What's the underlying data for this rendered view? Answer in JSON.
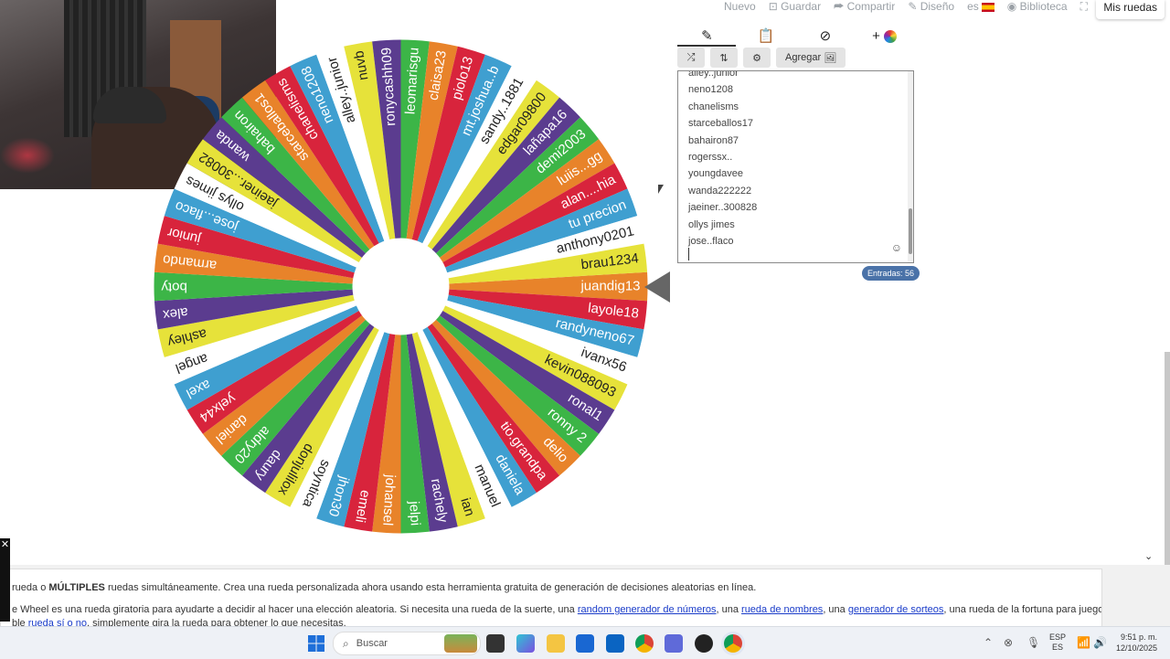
{
  "topnav": {
    "items": [
      "Nuevo",
      "Guardar",
      "Compartir",
      "Diseño",
      "es",
      "Biblioteca"
    ],
    "icons": [
      "",
      "save-icon",
      "share-icon",
      "pencil-icon",
      "spain-flag-icon",
      "palette-icon"
    ],
    "fullscreen_icon": "fullscreen-icon",
    "mis_ruedas": "Mis ruedas"
  },
  "wheel": {
    "segments": [
      "juandig13",
      "layole18",
      "randyneno67",
      "ivanx56",
      "kevin088093",
      "ronal1",
      "ronny 2",
      "delio",
      "tio.grandpa",
      "daniela",
      "manuel",
      "ian",
      "rachely",
      "jelpi",
      "johansel",
      "emeli",
      "jhon30",
      "soyntica",
      "donjulilox",
      "daury",
      "aldry20",
      "daniel",
      "yelx44",
      "axel",
      "angel",
      "ashley",
      "alex",
      "boty",
      "armando",
      "junior",
      "jose...flaco",
      "ollys jimes",
      "jaeiner...30082",
      "wanda",
      "bahairon",
      "starceballos1",
      "chanelisms",
      "neno1208",
      "alley..junior",
      "nuvb",
      "ronycashh09",
      "leomarisgu",
      "claisa23",
      "piolo13",
      "mt.joshua..b",
      "sandy..1881",
      "edgar09800",
      "lañapa16",
      "demi2003",
      "luiis...gg",
      "alan....hia",
      "tu precion",
      "anthony0201",
      "brau1234"
    ],
    "colors": [
      "#e8832a",
      "#d8243c",
      "#3f9fd0",
      "#ffffff",
      "#e6e23a",
      "#5b3c8f",
      "#3cb547",
      "#e8832a",
      "#d8243c",
      "#3f9fd0",
      "#ffffff",
      "#e6e23a",
      "#5b3c8f",
      "#3cb547",
      "#e8832a",
      "#d8243c",
      "#3f9fd0",
      "#ffffff",
      "#e6e23a",
      "#5b3c8f",
      "#3cb547",
      "#e8832a",
      "#d8243c",
      "#3f9fd0",
      "#ffffff",
      "#e6e23a",
      "#5b3c8f",
      "#3cb547",
      "#e8832a",
      "#d8243c",
      "#3f9fd0",
      "#ffffff",
      "#e6e23a",
      "#5b3c8f",
      "#3cb547",
      "#e8832a",
      "#d8243c",
      "#3f9fd0",
      "#ffffff",
      "#e6e23a",
      "#5b3c8f",
      "#3cb547",
      "#e8832a",
      "#d8243c",
      "#3f9fd0",
      "#ffffff",
      "#e6e23a",
      "#5b3c8f",
      "#3cb547",
      "#e8832a",
      "#d8243c",
      "#3f9fd0",
      "#ffffff",
      "#e6e23a",
      "#5b3c8f",
      "#3cb547"
    ]
  },
  "panel": {
    "tabs": [
      "pencil-icon",
      "clipboard-icon",
      "eye-slash-icon",
      "add-wheel-icon"
    ],
    "add_tab_label": "+",
    "toolbar": {
      "shuffle_icon": "shuffle-icon",
      "sort_icon": "sort-icon",
      "settings_icon": "settings-icon",
      "agregar": "Agregar"
    },
    "entries": [
      "alley..junior",
      "neno1208",
      "chanelisms",
      "starceballos17",
      "bahairon87",
      "rogerssx..",
      "youngdavee",
      "wanda222222",
      "jaeiner..300828",
      "ollys jimes",
      "jose..flaco"
    ],
    "entries_count": "Entradas: 56"
  },
  "description": {
    "line1_pre": "rueda o ",
    "line1_bold": "MÚLTIPLES",
    "line1_post": " ruedas simultáneamente. Crea una rueda personalizada ahora usando esta herramienta gratuita de generación de decisiones aleatorias en línea.",
    "line2_pre": "e Wheel es una rueda giratoria para ayudarte a decidir al hacer una elección aleatoria. Si necesita una rueda de la suerte, una ",
    "link1": "random generador de números",
    "line2_mid1": ", una ",
    "link2": "rueda de nombres",
    "line2_mid2": ", una ",
    "link3": "generador de sorteos",
    "line2_post": ", una rueda de la fortuna para juegos o una",
    "line3_pre": "ble ",
    "link4": "rueda sí o no",
    "line3_post": ", simplemente gira la rueda para obtener lo que necesitas."
  },
  "taskbar": {
    "search_placeholder": "Buscar",
    "lang_top": "ESP",
    "lang_bottom": "ES",
    "time": "9:51 p. m.",
    "date": "12/10/2025"
  }
}
